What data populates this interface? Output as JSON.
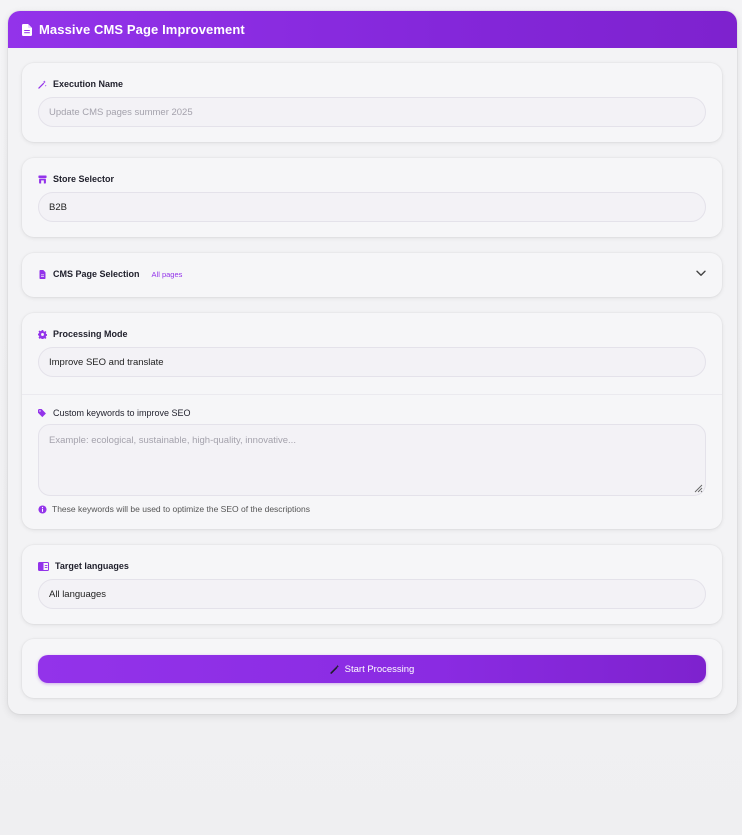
{
  "header": {
    "title": "Massive CMS Page Improvement",
    "icon": "document-icon"
  },
  "execution": {
    "label": "Execution Name",
    "icon": "magic-wand-icon",
    "placeholder": "Update CMS pages summer 2025"
  },
  "store": {
    "label": "Store Selector",
    "icon": "store-icon",
    "value": "B2B"
  },
  "cms_pages": {
    "label": "CMS Page Selection",
    "icon": "document-icon",
    "badge": "All pages"
  },
  "processing": {
    "label": "Processing Mode",
    "icon": "gear-icon",
    "value": "Improve SEO and translate",
    "keywords_label": "Custom keywords to improve SEO",
    "keywords_icon": "tags-icon",
    "keywords_placeholder": "Example: ecological, sustainable, high-quality, innovative...",
    "hint": "These keywords will be used to optimize the SEO of the descriptions",
    "hint_icon": "info-icon"
  },
  "languages": {
    "label": "Target languages",
    "icon": "language-icon",
    "value": "All languages"
  },
  "submit": {
    "label": "Start Processing",
    "icon": "magic-wand-icon"
  },
  "colors": {
    "accent": "#9333ea",
    "accent_dark": "#7e22ce"
  }
}
